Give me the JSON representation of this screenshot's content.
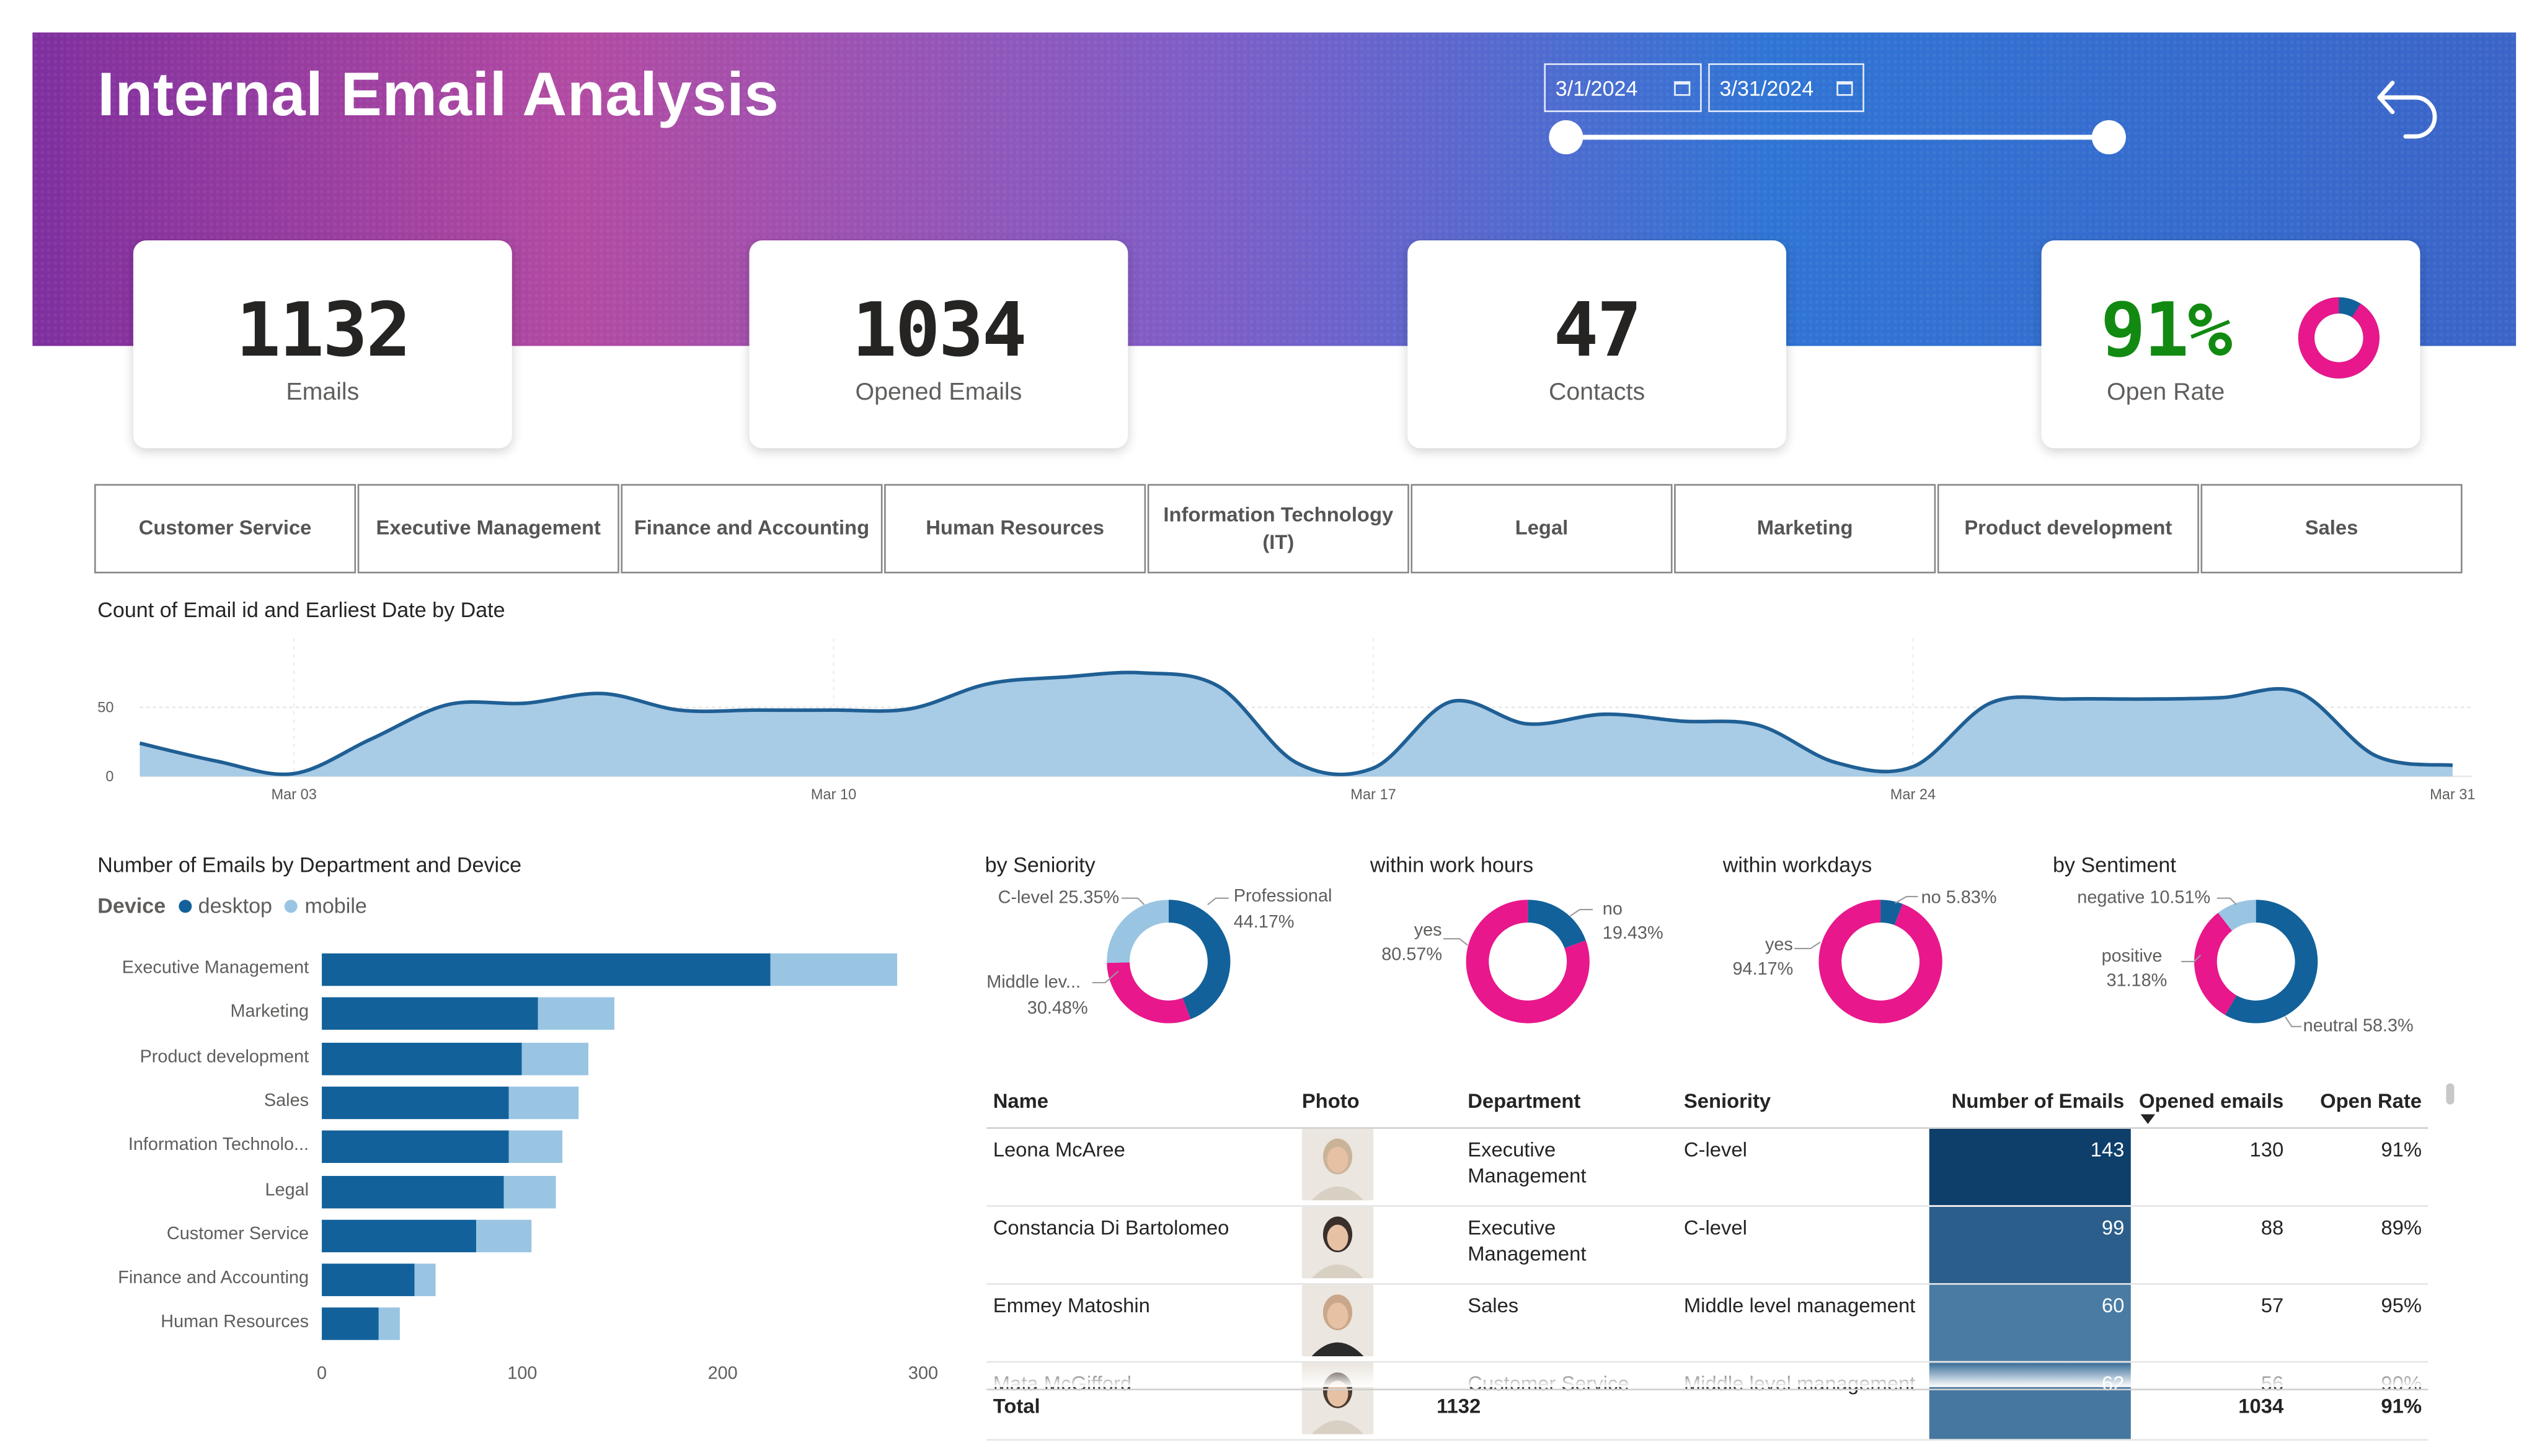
{
  "header": {
    "title": "Internal Email Analysis",
    "date_from": "3/1/2024",
    "date_to": "3/31/2024",
    "back_icon": "back-arrow-icon",
    "calendar_icon": "calendar-icon"
  },
  "kpis": {
    "emails": {
      "value": "1132",
      "label": "Emails"
    },
    "opened": {
      "value": "1034",
      "label": "Opened Emails"
    },
    "contacts": {
      "value": "47",
      "label": "Contacts"
    },
    "open_rate": {
      "value": "91%",
      "label": "Open Rate",
      "fraction": 0.91,
      "color": "#128a12"
    }
  },
  "departments": [
    "Customer Service",
    "Executive Management",
    "Finance and Accounting",
    "Human Resources",
    "Information Technology (IT)",
    "Legal",
    "Marketing",
    "Product development",
    "Sales"
  ],
  "colors": {
    "dark_blue": "#12619a",
    "light_blue": "#99c5e3",
    "pink": "#e8178c",
    "area_fill": "#a8cbe6",
    "area_line": "#1f5f94"
  },
  "line_chart": {
    "title": "Count of Email id and Earliest Date by Date",
    "y_ticks": [
      "0",
      "50"
    ],
    "x_ticks": [
      "Mar 03",
      "Mar 10",
      "Mar 17",
      "Mar 24",
      "Mar 31"
    ]
  },
  "bar_chart": {
    "title": "Number of Emails by Department and Device",
    "legend_title": "Device",
    "legend": [
      "desktop",
      "mobile"
    ],
    "x_ticks": [
      "0",
      "100",
      "200",
      "300"
    ]
  },
  "donuts": {
    "seniority": {
      "title": "by Seniority",
      "labels": [
        "Professional",
        "44.17%",
        "C-level 25.35%",
        "Middle lev...",
        "30.48%"
      ]
    },
    "work_hours": {
      "title": "within work hours",
      "labels": [
        "no",
        "19.43%",
        "yes",
        "80.57%"
      ]
    },
    "workdays": {
      "title": "within workdays",
      "labels": [
        "no 5.83%",
        "yes",
        "94.17%"
      ]
    },
    "sentiment": {
      "title": "by Sentiment",
      "labels": [
        "negative 10.51%",
        "positive",
        "31.18%",
        "neutral 58.3%"
      ]
    }
  },
  "table": {
    "columns": [
      "Name",
      "Photo",
      "Department",
      "Seniority",
      "Number of Emails",
      "Opened emails",
      "Open Rate"
    ],
    "sort_icon": "sort-desc-icon",
    "rows": [
      {
        "name": "Leona McAree",
        "department": "Executive Management",
        "seniority": "C-level",
        "emails": "143",
        "opened": "130",
        "rate": "91%",
        "shade": "#0e3f6b"
      },
      {
        "name": "Constancia Di Bartolomeo",
        "department": "Executive Management",
        "seniority": "C-level",
        "emails": "99",
        "opened": "88",
        "rate": "89%",
        "shade": "#2b5e8a"
      },
      {
        "name": "Emmey Matoshin",
        "department": "Sales",
        "seniority": "Middle level management",
        "emails": "60",
        "opened": "57",
        "rate": "95%",
        "shade": "#4a7ba3"
      },
      {
        "name": "Mata McGifford",
        "department": "Customer Service",
        "seniority": "Middle level management",
        "emails": "62",
        "opened": "56",
        "rate": "90%",
        "shade": "#4677a0"
      }
    ],
    "total": {
      "label": "Total",
      "emails": "1132",
      "opened": "1034",
      "rate": "91%"
    }
  },
  "chart_data": [
    {
      "type": "area",
      "title": "Count of Email id and Earliest Date by Date",
      "xlabel": "",
      "ylabel": "",
      "x": [
        "Mar 01",
        "Mar 02",
        "Mar 03",
        "Mar 04",
        "Mar 05",
        "Mar 06",
        "Mar 07",
        "Mar 08",
        "Mar 09",
        "Mar 10",
        "Mar 11",
        "Mar 12",
        "Mar 13",
        "Mar 14",
        "Mar 15",
        "Mar 16",
        "Mar 17",
        "Mar 18",
        "Mar 19",
        "Mar 20",
        "Mar 21",
        "Mar 22",
        "Mar 23",
        "Mar 24",
        "Mar 25",
        "Mar 26",
        "Mar 27",
        "Mar 28",
        "Mar 29",
        "Mar 30",
        "Mar 31"
      ],
      "values": [
        24,
        11,
        2,
        27,
        52,
        53,
        60,
        48,
        48,
        48,
        49,
        67,
        72,
        75,
        65,
        10,
        6,
        54,
        38,
        45,
        40,
        37,
        10,
        7,
        53,
        56,
        56,
        57,
        61,
        15,
        8
      ],
      "ylim": [
        0,
        100
      ],
      "grid": true
    },
    {
      "type": "bar",
      "orientation": "horizontal",
      "stacked": true,
      "title": "Number of Emails by Department and Device",
      "categories": [
        "Executive Management",
        "Marketing",
        "Product development",
        "Sales",
        "Information Technolo...",
        "Legal",
        "Customer Service",
        "Finance and Accounting",
        "Human Resources"
      ],
      "series": [
        {
          "name": "desktop",
          "values": [
            224,
            108,
            100,
            93,
            93,
            91,
            77,
            46,
            28
          ]
        },
        {
          "name": "mobile",
          "values": [
            63,
            38,
            33,
            35,
            27,
            26,
            28,
            11,
            11
          ]
        }
      ],
      "xlim": [
        0,
        300
      ]
    },
    {
      "type": "pie",
      "donut": true,
      "title": "by Seniority",
      "categories": [
        "Professional",
        "Middle level management",
        "C-level"
      ],
      "values": [
        44.17,
        30.48,
        25.35
      ]
    },
    {
      "type": "pie",
      "donut": true,
      "title": "within work hours",
      "categories": [
        "no",
        "yes"
      ],
      "values": [
        19.43,
        80.57
      ]
    },
    {
      "type": "pie",
      "donut": true,
      "title": "within workdays",
      "categories": [
        "no",
        "yes"
      ],
      "values": [
        5.83,
        94.17
      ]
    },
    {
      "type": "pie",
      "donut": true,
      "title": "by Sentiment",
      "categories": [
        "neutral",
        "positive",
        "negative"
      ],
      "values": [
        58.3,
        31.18,
        10.51
      ]
    }
  ]
}
